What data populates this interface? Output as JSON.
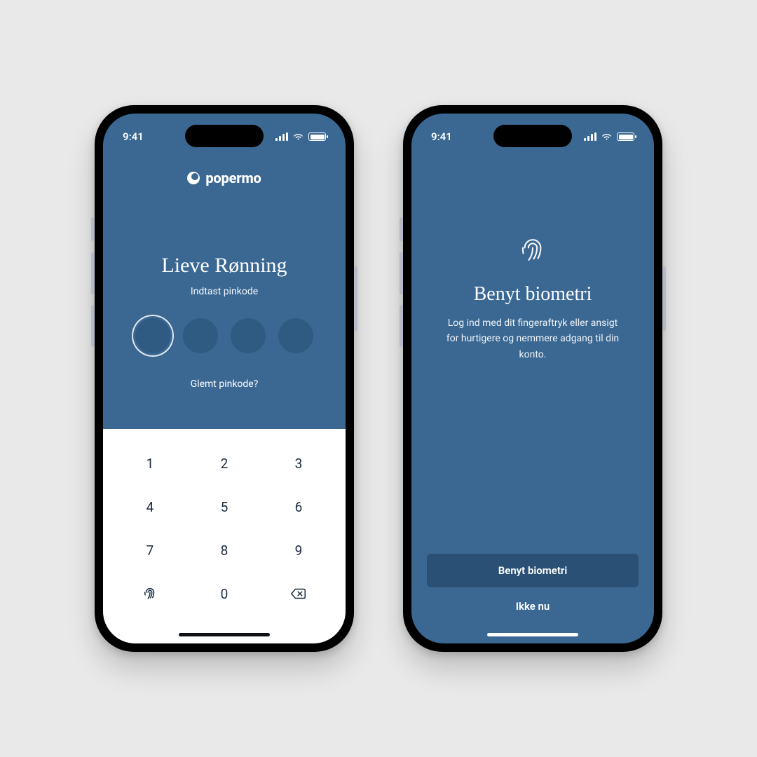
{
  "colors": {
    "brand_bg": "#3a6893",
    "brand_dark": "#2a5076",
    "pin_fill": "#2f5a81"
  },
  "status": {
    "time": "9:41"
  },
  "brand": {
    "name": "popermo"
  },
  "pin_screen": {
    "user_name": "Lieve Rønning",
    "subtitle": "Indtast pinkode",
    "pin_digits": 4,
    "active_index": 0,
    "forgot_label": "Glemt pinkode?",
    "keys": [
      "1",
      "2",
      "3",
      "4",
      "5",
      "6",
      "7",
      "8",
      "9",
      "fingerprint",
      "0",
      "backspace"
    ]
  },
  "biometry_screen": {
    "title": "Benyt biometri",
    "description": "Log ind med dit fingeraftryk eller ansigt for hurtigere og nemmere adgang til din konto.",
    "primary_button": "Benyt biometri",
    "secondary_button": "Ikke nu"
  }
}
